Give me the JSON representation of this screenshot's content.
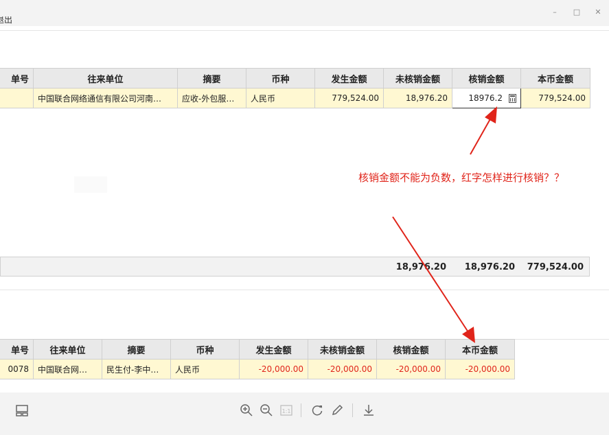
{
  "window": {
    "title": "退出",
    "buttons": {
      "minimize": "–",
      "maximize": "□",
      "close": "✕"
    }
  },
  "top_table": {
    "columns": [
      "单号",
      "往来单位",
      "摘要",
      "币种",
      "发生金额",
      "未核销金额",
      "核销金额",
      "本币金额"
    ],
    "rows": [
      {
        "bill_no": "",
        "partner": "中国联合网络通信有限公司河南…",
        "summary": "应收-外包服…",
        "currency": "人民币",
        "amount": "779,524.00",
        "unverified": "18,976.20",
        "verify_input": "18976.2",
        "local_amount": "779,524.00"
      }
    ],
    "totals": {
      "unverified": "18,976.20",
      "verified": "18,976.20",
      "local_amount": "779,524.00"
    }
  },
  "annotation": {
    "text": "核销金额不能为负数，红字怎样进行核销？？",
    "color": "#e0241a"
  },
  "bottom_table": {
    "columns": [
      "单号",
      "往来单位",
      "摘要",
      "币种",
      "发生金额",
      "未核销金额",
      "核销金额",
      "本币金额"
    ],
    "rows": [
      {
        "bill_no": "0078",
        "partner": "中国联合网…",
        "summary": "民生付-李中…",
        "currency": "人民币",
        "amount": "-20,000.00",
        "unverified": "-20,000.00",
        "verified": "-20,000.00",
        "local_amount": "-20,000.00"
      }
    ]
  },
  "footer_icons": [
    "layout-icon",
    "zoom-in-icon",
    "zoom-out-icon",
    "actual-size-icon",
    "rotate-icon",
    "edit-pen-icon",
    "download-icon"
  ],
  "footer_actual_size_label": "1:1"
}
